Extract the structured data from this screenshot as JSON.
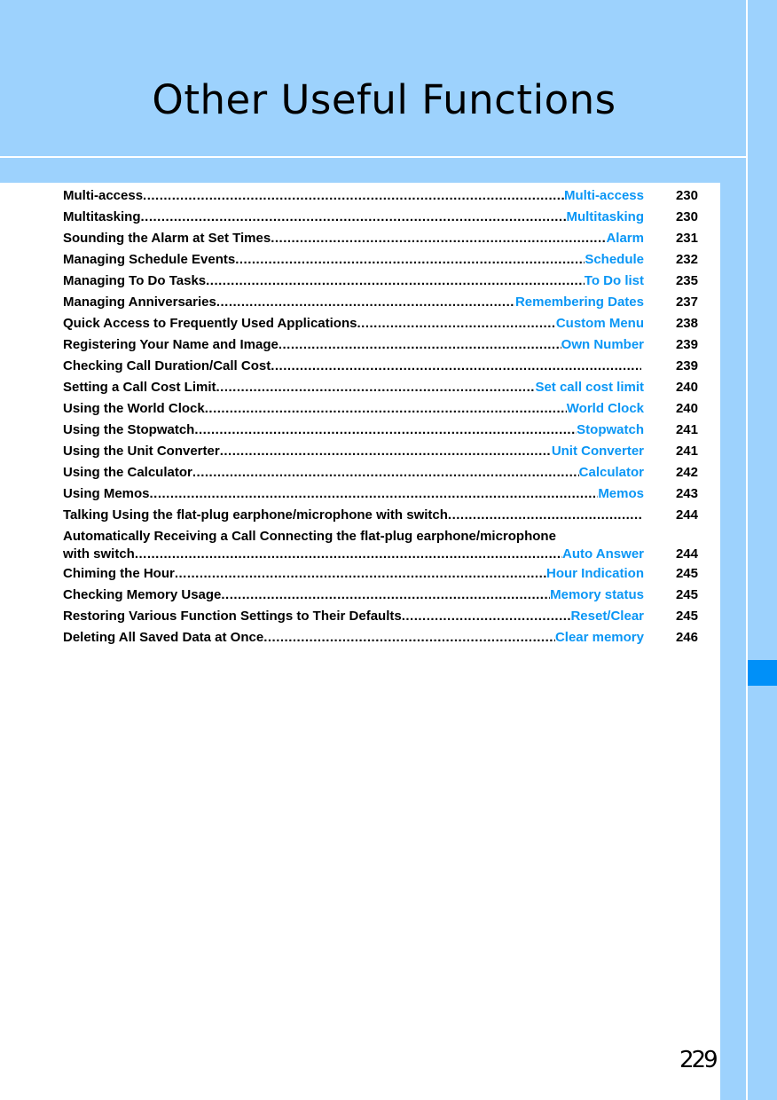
{
  "chapter": {
    "title": "Other Useful Functions"
  },
  "colors": {
    "background_blue": "#9dd2fd",
    "accent_tab": "#0090f8",
    "reference_text": "#0a96f5"
  },
  "toc": [
    {
      "title": "Multi-access",
      "ref": "Multi-access",
      "page": "230"
    },
    {
      "title": "Multitasking ",
      "ref": " Multitasking",
      "page": "230"
    },
    {
      "title": "Sounding the Alarm at Set Times",
      "ref": " Alarm",
      "page": "231"
    },
    {
      "title": "Managing Schedule Events",
      "ref": " Schedule",
      "page": "232"
    },
    {
      "title": "Managing To Do Tasks ",
      "ref": " To Do list",
      "page": "235"
    },
    {
      "title": "Managing Anniversaries",
      "ref": "Remembering Dates",
      "page": "237"
    },
    {
      "title": "Quick Access to Frequently Used Applications ",
      "ref": "Custom Menu",
      "page": "238"
    },
    {
      "title": "Registering Your Name and Image",
      "ref": " Own Number",
      "page": "239"
    },
    {
      "title": "Checking Call Duration/Call Cost ",
      "ref": "",
      "page": "239"
    },
    {
      "title": "Setting a Call Cost Limit",
      "ref": " Set call cost limit",
      "page": "240"
    },
    {
      "title": "Using the World Clock",
      "ref": " World Clock",
      "page": "240"
    },
    {
      "title": "Using the Stopwatch",
      "ref": " Stopwatch",
      "page": "241"
    },
    {
      "title": "Using the Unit Converter",
      "ref": " Unit Converter",
      "page": "241"
    },
    {
      "title": "Using the Calculator ",
      "ref": "Calculator",
      "page": "242"
    },
    {
      "title": "Using Memos",
      "ref": " Memos",
      "page": "243"
    },
    {
      "title": "Talking Using the flat-plug earphone/microphone with switch",
      "ref": "",
      "page": "244"
    },
    {
      "title_line1": "Automatically Receiving a Call Connecting the flat-plug earphone/microphone",
      "title": "with switch",
      "ref": " Auto Answer",
      "page": "244"
    },
    {
      "title": "Chiming the Hour",
      "ref": " Hour Indication",
      "page": "245"
    },
    {
      "title": "Checking Memory Usage ",
      "ref": " Memory status",
      "page": "245"
    },
    {
      "title": "Restoring Various Function Settings to Their Defaults ",
      "ref": "Reset/Clear",
      "page": "245"
    },
    {
      "title": "Deleting All Saved Data at Once",
      "ref": " Clear memory",
      "page": "246"
    }
  ],
  "footer": {
    "page_number": "229"
  }
}
